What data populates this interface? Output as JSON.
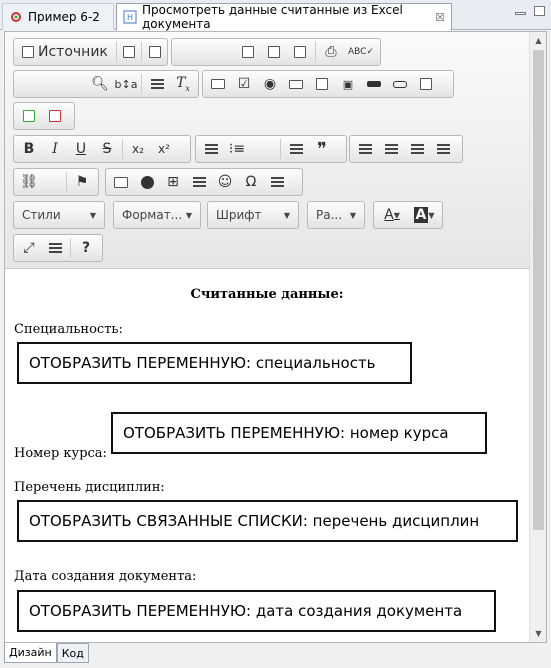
{
  "tabs": [
    {
      "label": "Пример 6-2",
      "icon": "gear-icon",
      "active": false
    },
    {
      "label": "Просмотреть данные считанные из Excel документа",
      "icon": "form-icon",
      "active": true
    }
  ],
  "toolbar": {
    "source_label": "Источник",
    "combos": {
      "styles": "Стили",
      "format": "Формат...",
      "font": "Шрифт",
      "size": "Ра..."
    },
    "bold": "B",
    "italic": "I",
    "underline": "U",
    "strike": "S",
    "subscript": "x₂",
    "superscript": "x²",
    "quote": "❞",
    "omega": "Ω",
    "help": "?",
    "smiley": "☺",
    "font_color_letter": "A",
    "bg_color_letter": "A"
  },
  "content": {
    "title": "Считанные данные:",
    "sections": [
      {
        "label": "Специальность:",
        "box": "ОТОБРАЗИТЬ ПЕРЕМЕННУЮ: специальность"
      },
      {
        "label": "Номер курса:",
        "box": "ОТОБРАЗИТЬ ПЕРЕМЕННУЮ: номер курса"
      },
      {
        "label": "Перечень дисциплин:",
        "box": "ОТОБРАЗИТЬ СВЯЗАННЫЕ СПИСКИ: перечень дисциплин"
      },
      {
        "label": "Дата создания документа:",
        "box": "ОТОБРАЗИТЬ ПЕРЕМЕННУЮ: дата создания документа"
      }
    ]
  },
  "bottom_tabs": [
    {
      "label": "Дизайн",
      "active": true
    },
    {
      "label": "Код",
      "active": false
    }
  ],
  "colors": {
    "accent": "#3c78c8",
    "border": "#111111"
  }
}
